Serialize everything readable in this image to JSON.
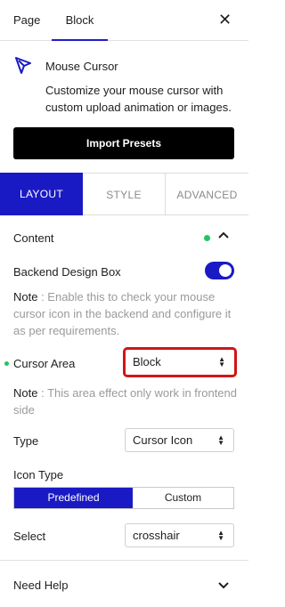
{
  "top_tabs": {
    "page": "Page",
    "block": "Block",
    "close_icon": "close-icon"
  },
  "block_info": {
    "icon": "mouse-cursor-block-icon",
    "title": "Mouse Cursor",
    "description": "Customize your mouse cursor with custom upload animation or images."
  },
  "import_presets_label": "Import Presets",
  "mode_tabs": {
    "layout": "LAYOUT",
    "style": "STYLE",
    "advanced": "ADVANCED"
  },
  "content_section": {
    "title": "Content",
    "backend_design_box": {
      "label": "Backend Design Box",
      "enabled": true,
      "note_label": "Note",
      "note_text": " : Enable this to check your mouse cursor icon in the backend and configure it as per requirements."
    },
    "cursor_area": {
      "label": "Cursor Area",
      "value": "Block",
      "note_label": "Note",
      "note_text": " : This area effect only work in frontend side"
    },
    "type": {
      "label": "Type",
      "value": "Cursor Icon"
    },
    "icon_type": {
      "label": "Icon Type",
      "options": [
        "Predefined",
        "Custom"
      ],
      "selected": "Predefined"
    },
    "select": {
      "label": "Select",
      "value": "crosshair"
    }
  },
  "need_help": {
    "title": "Need Help"
  },
  "colors": {
    "accent": "#1a1ac4",
    "highlight": "#d01616",
    "status_green": "#22c55e"
  }
}
